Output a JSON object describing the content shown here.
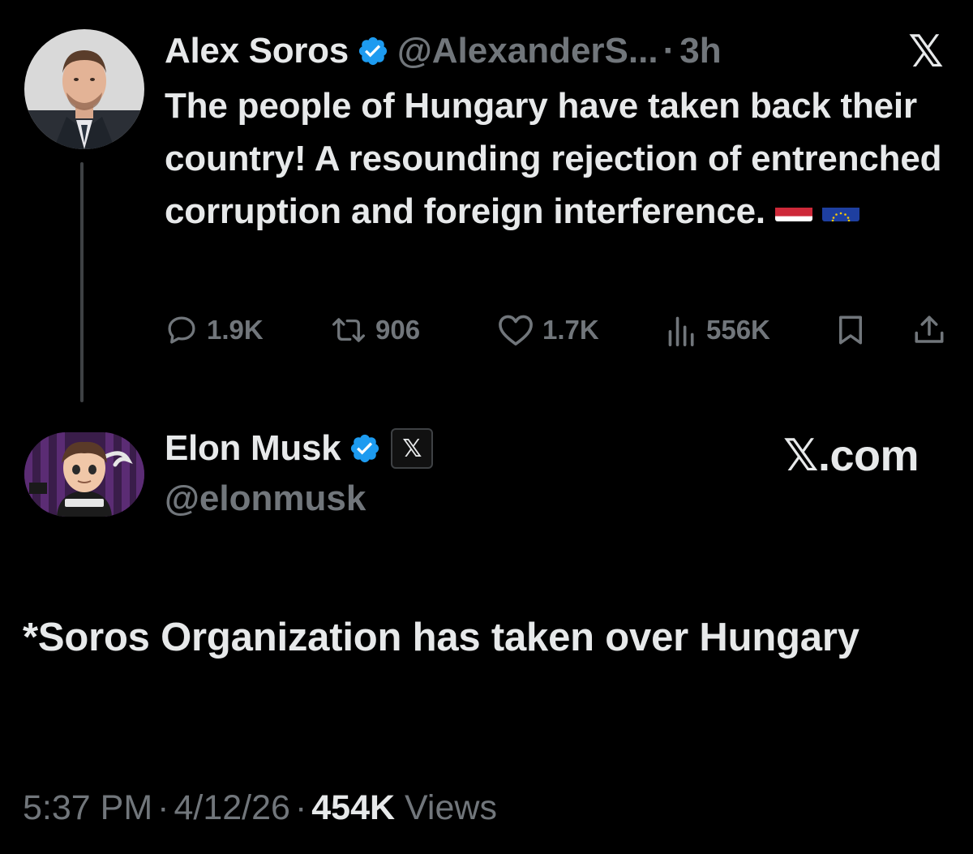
{
  "parent_tweet": {
    "author_name": "Alex Soros",
    "author_handle": "@AlexanderS...",
    "separator": "·",
    "time": "3h",
    "text": "The people of Hungary have taken back their country! A resounding rejection of entrenched corruption and foreign interference.",
    "flags": [
      "hungary-flag-icon",
      "eu-flag-icon"
    ],
    "platform_logo": "𝕏",
    "actions": {
      "replies": "1.9K",
      "reposts": "906",
      "likes": "1.7K",
      "views": "556K"
    }
  },
  "main_tweet": {
    "author_name": "Elon Musk",
    "author_handle": "@elonmusk",
    "affiliate_badge": "𝕏",
    "follow_site": "𝕏.com",
    "text": "*Soros Organization has taken over Hungary",
    "meta": {
      "time": "5:37 PM",
      "date": "4/12/26",
      "separator": "·",
      "views_count": "454K",
      "views_label": "Views"
    }
  },
  "colors": {
    "background": "#000000",
    "text_primary": "#e7e9ea",
    "text_secondary": "#71767b",
    "verified_blue": "#1d9bf0",
    "thread_line": "#3e4144"
  }
}
